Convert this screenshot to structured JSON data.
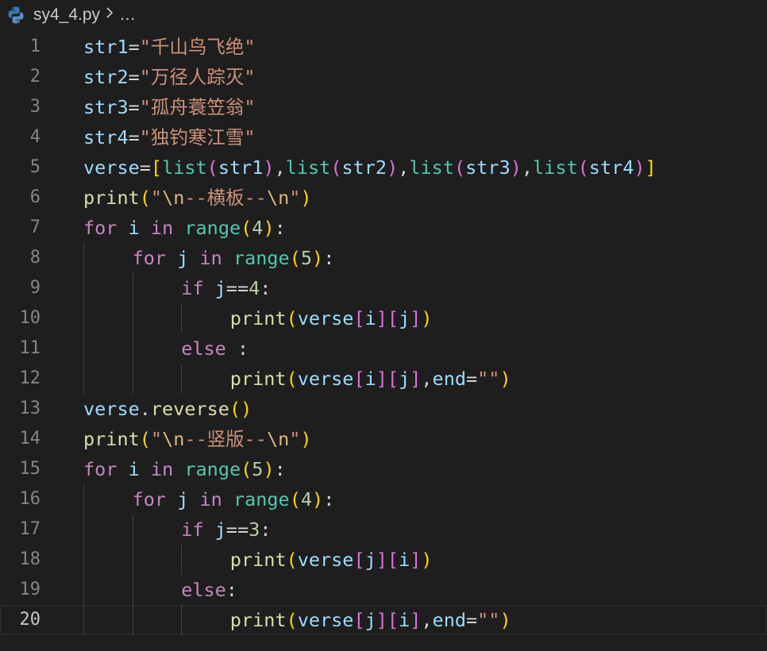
{
  "breadcrumb": {
    "file_name": "sy4_4.py",
    "ellipsis": "…",
    "file_icon": "python-icon"
  },
  "editor": {
    "current_line": 20,
    "lines": [
      {
        "n": "1",
        "indent": 0,
        "tokens": [
          {
            "t": "str1",
            "c": "var"
          },
          {
            "t": "=",
            "c": "op"
          },
          {
            "t": "\"千山鸟飞绝\"",
            "c": "str"
          }
        ]
      },
      {
        "n": "2",
        "indent": 0,
        "tokens": [
          {
            "t": "str2",
            "c": "var"
          },
          {
            "t": "=",
            "c": "op"
          },
          {
            "t": "\"万径人踪灭\"",
            "c": "str"
          }
        ]
      },
      {
        "n": "3",
        "indent": 0,
        "tokens": [
          {
            "t": "str3",
            "c": "var"
          },
          {
            "t": "=",
            "c": "op"
          },
          {
            "t": "\"孤舟蓑笠翁\"",
            "c": "str"
          }
        ]
      },
      {
        "n": "4",
        "indent": 0,
        "tokens": [
          {
            "t": "str4",
            "c": "var"
          },
          {
            "t": "=",
            "c": "op"
          },
          {
            "t": "\"独钓寒江雪\"",
            "c": "str"
          }
        ]
      },
      {
        "n": "5",
        "indent": 0,
        "tokens": [
          {
            "t": "verse",
            "c": "var"
          },
          {
            "t": "=",
            "c": "op"
          },
          {
            "t": "[",
            "c": "b1"
          },
          {
            "t": "list",
            "c": "cls"
          },
          {
            "t": "(",
            "c": "b2"
          },
          {
            "t": "str1",
            "c": "var"
          },
          {
            "t": ")",
            "c": "b2"
          },
          {
            "t": ",",
            "c": "op"
          },
          {
            "t": "list",
            "c": "cls"
          },
          {
            "t": "(",
            "c": "b2"
          },
          {
            "t": "str2",
            "c": "var"
          },
          {
            "t": ")",
            "c": "b2"
          },
          {
            "t": ",",
            "c": "op"
          },
          {
            "t": "list",
            "c": "cls"
          },
          {
            "t": "(",
            "c": "b2"
          },
          {
            "t": "str3",
            "c": "var"
          },
          {
            "t": ")",
            "c": "b2"
          },
          {
            "t": ",",
            "c": "op"
          },
          {
            "t": "list",
            "c": "cls"
          },
          {
            "t": "(",
            "c": "b2"
          },
          {
            "t": "str4",
            "c": "var"
          },
          {
            "t": ")",
            "c": "b2"
          },
          {
            "t": "]",
            "c": "b1"
          }
        ]
      },
      {
        "n": "6",
        "indent": 0,
        "tokens": [
          {
            "t": "print",
            "c": "fn"
          },
          {
            "t": "(",
            "c": "b1"
          },
          {
            "t": "\"",
            "c": "str"
          },
          {
            "t": "\\n",
            "c": "esc"
          },
          {
            "t": "--横板--",
            "c": "str"
          },
          {
            "t": "\\n",
            "c": "esc"
          },
          {
            "t": "\"",
            "c": "str"
          },
          {
            "t": ")",
            "c": "b1"
          }
        ]
      },
      {
        "n": "7",
        "indent": 0,
        "tokens": [
          {
            "t": "for",
            "c": "kw"
          },
          {
            "t": " ",
            "c": "op"
          },
          {
            "t": "i",
            "c": "var"
          },
          {
            "t": " ",
            "c": "op"
          },
          {
            "t": "in",
            "c": "kw"
          },
          {
            "t": " ",
            "c": "op"
          },
          {
            "t": "range",
            "c": "cls"
          },
          {
            "t": "(",
            "c": "b1"
          },
          {
            "t": "4",
            "c": "num"
          },
          {
            "t": ")",
            "c": "b1"
          },
          {
            "t": ":",
            "c": "op"
          }
        ]
      },
      {
        "n": "8",
        "indent": 1,
        "tokens": [
          {
            "t": "for",
            "c": "kw"
          },
          {
            "t": " ",
            "c": "op"
          },
          {
            "t": "j",
            "c": "var"
          },
          {
            "t": " ",
            "c": "op"
          },
          {
            "t": "in",
            "c": "kw"
          },
          {
            "t": " ",
            "c": "op"
          },
          {
            "t": "range",
            "c": "cls"
          },
          {
            "t": "(",
            "c": "b1"
          },
          {
            "t": "5",
            "c": "num"
          },
          {
            "t": ")",
            "c": "b1"
          },
          {
            "t": ":",
            "c": "op"
          }
        ]
      },
      {
        "n": "9",
        "indent": 2,
        "tokens": [
          {
            "t": "if",
            "c": "kw"
          },
          {
            "t": " ",
            "c": "op"
          },
          {
            "t": "j",
            "c": "var"
          },
          {
            "t": "==",
            "c": "op"
          },
          {
            "t": "4",
            "c": "num"
          },
          {
            "t": ":",
            "c": "op"
          }
        ]
      },
      {
        "n": "10",
        "indent": 3,
        "tokens": [
          {
            "t": "print",
            "c": "fn"
          },
          {
            "t": "(",
            "c": "b1"
          },
          {
            "t": "verse",
            "c": "var"
          },
          {
            "t": "[",
            "c": "b2"
          },
          {
            "t": "i",
            "c": "var"
          },
          {
            "t": "]",
            "c": "b2"
          },
          {
            "t": "[",
            "c": "b2"
          },
          {
            "t": "j",
            "c": "var"
          },
          {
            "t": "]",
            "c": "b2"
          },
          {
            "t": ")",
            "c": "b1"
          }
        ]
      },
      {
        "n": "11",
        "indent": 2,
        "tokens": [
          {
            "t": "else",
            "c": "kw"
          },
          {
            "t": " :",
            "c": "op"
          }
        ]
      },
      {
        "n": "12",
        "indent": 3,
        "tokens": [
          {
            "t": "print",
            "c": "fn"
          },
          {
            "t": "(",
            "c": "b1"
          },
          {
            "t": "verse",
            "c": "var"
          },
          {
            "t": "[",
            "c": "b2"
          },
          {
            "t": "i",
            "c": "var"
          },
          {
            "t": "]",
            "c": "b2"
          },
          {
            "t": "[",
            "c": "b2"
          },
          {
            "t": "j",
            "c": "var"
          },
          {
            "t": "]",
            "c": "b2"
          },
          {
            "t": ",",
            "c": "op"
          },
          {
            "t": "end",
            "c": "var"
          },
          {
            "t": "=",
            "c": "op"
          },
          {
            "t": "\"\"",
            "c": "str"
          },
          {
            "t": ")",
            "c": "b1"
          }
        ]
      },
      {
        "n": "13",
        "indent": 0,
        "tokens": [
          {
            "t": "verse",
            "c": "var"
          },
          {
            "t": ".",
            "c": "op"
          },
          {
            "t": "reverse",
            "c": "fn"
          },
          {
            "t": "()",
            "c": "b1"
          }
        ]
      },
      {
        "n": "14",
        "indent": 0,
        "tokens": [
          {
            "t": "print",
            "c": "fn"
          },
          {
            "t": "(",
            "c": "b1"
          },
          {
            "t": "\"",
            "c": "str"
          },
          {
            "t": "\\n",
            "c": "esc"
          },
          {
            "t": "--竖版--",
            "c": "str"
          },
          {
            "t": "\\n",
            "c": "esc"
          },
          {
            "t": "\"",
            "c": "str"
          },
          {
            "t": ")",
            "c": "b1"
          }
        ]
      },
      {
        "n": "15",
        "indent": 0,
        "tokens": [
          {
            "t": "for",
            "c": "kw"
          },
          {
            "t": " ",
            "c": "op"
          },
          {
            "t": "i",
            "c": "var"
          },
          {
            "t": " ",
            "c": "op"
          },
          {
            "t": "in",
            "c": "kw"
          },
          {
            "t": " ",
            "c": "op"
          },
          {
            "t": "range",
            "c": "cls"
          },
          {
            "t": "(",
            "c": "b1"
          },
          {
            "t": "5",
            "c": "num"
          },
          {
            "t": ")",
            "c": "b1"
          },
          {
            "t": ":",
            "c": "op"
          }
        ]
      },
      {
        "n": "16",
        "indent": 1,
        "tokens": [
          {
            "t": "for",
            "c": "kw"
          },
          {
            "t": " ",
            "c": "op"
          },
          {
            "t": "j",
            "c": "var"
          },
          {
            "t": " ",
            "c": "op"
          },
          {
            "t": "in",
            "c": "kw"
          },
          {
            "t": " ",
            "c": "op"
          },
          {
            "t": "range",
            "c": "cls"
          },
          {
            "t": "(",
            "c": "b1"
          },
          {
            "t": "4",
            "c": "num"
          },
          {
            "t": ")",
            "c": "b1"
          },
          {
            "t": ":",
            "c": "op"
          }
        ]
      },
      {
        "n": "17",
        "indent": 2,
        "tokens": [
          {
            "t": "if",
            "c": "kw"
          },
          {
            "t": " ",
            "c": "op"
          },
          {
            "t": "j",
            "c": "var"
          },
          {
            "t": "==",
            "c": "op"
          },
          {
            "t": "3",
            "c": "num"
          },
          {
            "t": ":",
            "c": "op"
          }
        ]
      },
      {
        "n": "18",
        "indent": 3,
        "tokens": [
          {
            "t": "print",
            "c": "fn"
          },
          {
            "t": "(",
            "c": "b1"
          },
          {
            "t": "verse",
            "c": "var"
          },
          {
            "t": "[",
            "c": "b2"
          },
          {
            "t": "j",
            "c": "var"
          },
          {
            "t": "]",
            "c": "b2"
          },
          {
            "t": "[",
            "c": "b2"
          },
          {
            "t": "i",
            "c": "var"
          },
          {
            "t": "]",
            "c": "b2"
          },
          {
            "t": ")",
            "c": "b1"
          }
        ]
      },
      {
        "n": "19",
        "indent": 2,
        "tokens": [
          {
            "t": "else",
            "c": "kw"
          },
          {
            "t": ":",
            "c": "op"
          }
        ]
      },
      {
        "n": "20",
        "indent": 3,
        "tokens": [
          {
            "t": "print",
            "c": "fn"
          },
          {
            "t": "(",
            "c": "b1"
          },
          {
            "t": "verse",
            "c": "var"
          },
          {
            "t": "[",
            "c": "b2"
          },
          {
            "t": "j",
            "c": "var"
          },
          {
            "t": "]",
            "c": "b2"
          },
          {
            "t": "[",
            "c": "b2"
          },
          {
            "t": "i",
            "c": "var"
          },
          {
            "t": "]",
            "c": "b2"
          },
          {
            "t": ",",
            "c": "op"
          },
          {
            "t": "end",
            "c": "var"
          },
          {
            "t": "=",
            "c": "op"
          },
          {
            "t": "\"\"",
            "c": "str"
          },
          {
            "t": ")",
            "c": "b1"
          }
        ]
      }
    ]
  }
}
